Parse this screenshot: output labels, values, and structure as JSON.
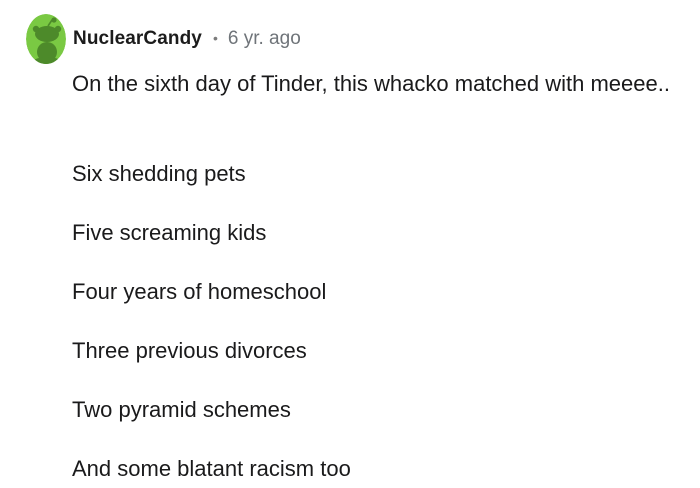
{
  "comment": {
    "author": "NuclearCandy",
    "separator": "•",
    "age": "6 yr. ago",
    "avatar_icon": "reddit-snoo-avatar-icon",
    "avatar_color": "#7ac943",
    "paragraph": "On the sixth day of Tinder, this whacko matched with meeee..",
    "lines": [
      "Six shedding pets",
      "Five screaming kids",
      "Four years of homeschool",
      "Three previous divorces",
      "Two pyramid schemes",
      "And some blatant racism too"
    ]
  }
}
